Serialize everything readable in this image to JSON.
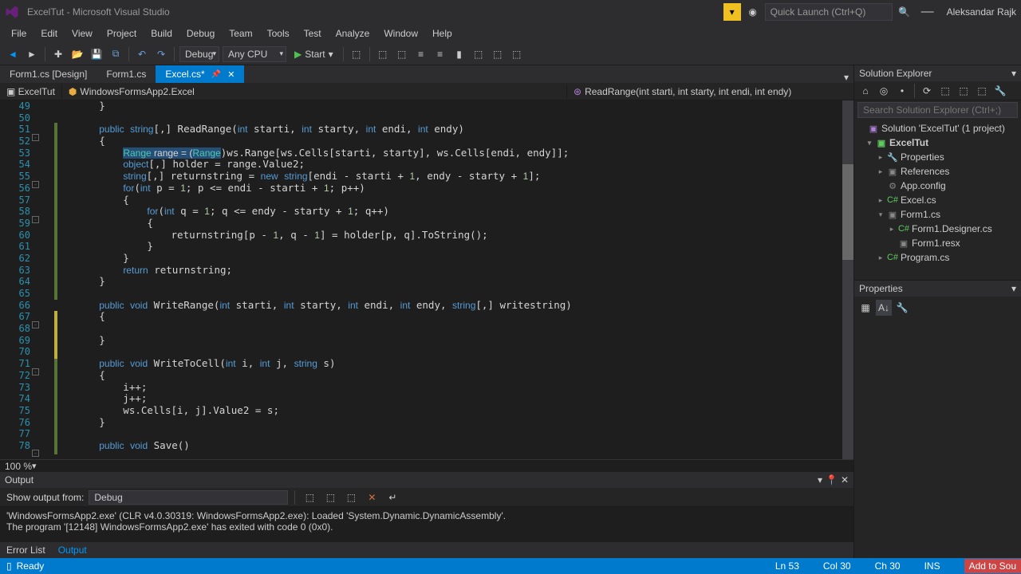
{
  "title": "ExcelTut - Microsoft Visual Studio",
  "quick_launch_placeholder": "Quick Launch (Ctrl+Q)",
  "user_name": "Aleksandar Rajk",
  "menu": [
    "File",
    "Edit",
    "View",
    "Project",
    "Build",
    "Debug",
    "Team",
    "Tools",
    "Test",
    "Analyze",
    "Window",
    "Help"
  ],
  "toolbar": {
    "config": "Debug",
    "platform": "Any CPU",
    "start_label": "Start"
  },
  "tabs": [
    {
      "label": "Form1.cs [Design]",
      "active": false
    },
    {
      "label": "Form1.cs",
      "active": false
    },
    {
      "label": "Excel.cs*",
      "active": true
    }
  ],
  "context": {
    "project": "ExcelTut",
    "class": "WindowsFormsApp2.Excel",
    "member": "ReadRange(int starti, int starty, int endi, int endy)"
  },
  "line_start": 49,
  "line_end": 78,
  "zoom": "100 %",
  "output_panel": {
    "title": "Output",
    "from_label": "Show output from:",
    "from_value": "Debug",
    "lines": [
      "'WindowsFormsApp2.exe' (CLR v4.0.30319: WindowsFormsApp2.exe): Loaded 'System.Dynamic.DynamicAssembly'.",
      "The program '[12148] WindowsFormsApp2.exe' has exited with code 0 (0x0)."
    ],
    "tabs": [
      {
        "label": "Error List",
        "active": false
      },
      {
        "label": "Output",
        "active": true
      }
    ]
  },
  "solution_explorer": {
    "title": "Solution Explorer",
    "search_placeholder": "Search Solution Explorer (Ctrl+;)",
    "solution_label": "Solution 'ExcelTut' (1 project)",
    "project": "ExcelTut",
    "items": [
      "Properties",
      "References",
      "App.config",
      "Excel.cs",
      "Form1.cs",
      "Form1.Designer.cs",
      "Form1.resx",
      "Program.cs"
    ]
  },
  "properties_panel": {
    "title": "Properties"
  },
  "status": {
    "ready": "Ready",
    "line": "Ln 53",
    "col": "Col 30",
    "ch": "Ch 30",
    "ins": "INS",
    "publish": "Add to Sou"
  }
}
